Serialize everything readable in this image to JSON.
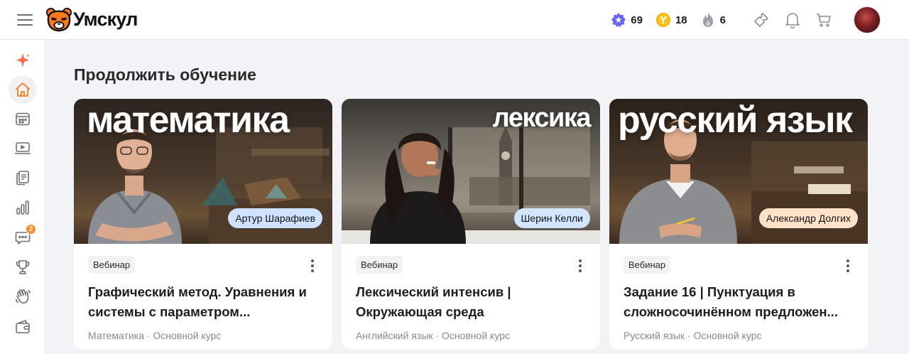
{
  "header": {
    "logo_text": "Умскул",
    "stats": [
      {
        "icon": "star-badge-icon",
        "value": "69",
        "color": "#5b5cf0"
      },
      {
        "icon": "coin-icon",
        "value": "18",
        "color": "#f5b400"
      },
      {
        "icon": "flame-icon",
        "value": "6",
        "color": "#8d9099"
      }
    ]
  },
  "sidebar": {
    "items": [
      {
        "icon": "sparkle-icon",
        "notifications": ""
      },
      {
        "icon": "home-icon",
        "notifications": ""
      },
      {
        "icon": "calendar-icon",
        "notifications": ""
      },
      {
        "icon": "laptop-icon",
        "notifications": ""
      },
      {
        "icon": "documents-icon",
        "notifications": ""
      },
      {
        "icon": "stats-icon",
        "notifications": ""
      },
      {
        "icon": "chat-icon",
        "notifications": "2"
      },
      {
        "icon": "trophy-icon",
        "notifications": ""
      },
      {
        "icon": "hand-wave-icon",
        "notifications": ""
      },
      {
        "icon": "wallet-icon",
        "notifications": ""
      }
    ]
  },
  "main": {
    "section_title": "Продолжить обучение",
    "cards": [
      {
        "cover_title": "математика",
        "teacher": "Артур Шарафиев",
        "type": "Вебинар",
        "title": "Графический метод. Уравнения и системы с параметром...",
        "meta": "Математика · Основной курс",
        "teacher_bg": "#cfe3ff"
      },
      {
        "cover_title": "лексика",
        "teacher": "Шерин Келли",
        "type": "Вебинар",
        "title": "Лексический интенсив | Окружающая среда",
        "meta": "Английский язык · Основной курс",
        "teacher_bg": "#d2e6ff"
      },
      {
        "cover_title": "русский язык",
        "teacher": "Александр Долгих",
        "type": "Вебинар",
        "title": "Задание 16 | Пунктуация в сложносочинённом предложен...",
        "meta": "Русский язык · Основной курс",
        "teacher_bg": "#ffe2c8"
      }
    ]
  },
  "colors": {
    "accent": "#ff7a1a",
    "badge": "#ff8a2b"
  }
}
